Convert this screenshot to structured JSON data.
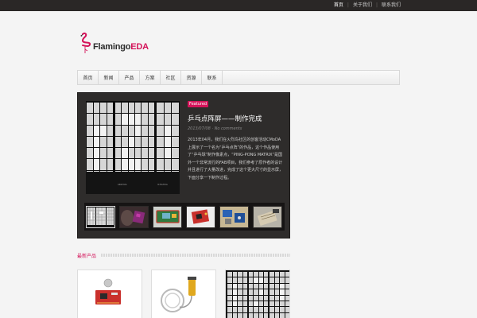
{
  "topnav": {
    "items": [
      "首页",
      "关于我们",
      "联系我们"
    ]
  },
  "logo": {
    "part1": "Flamingo",
    "part2": "EDA"
  },
  "menu": {
    "items": [
      "首页",
      "新闻",
      "产品",
      "方案",
      "社区",
      "资源",
      "联系"
    ]
  },
  "featured": {
    "badge": "Featured",
    "title": "乒乓点阵屏——制作完成",
    "meta": "2013/07/08 · No comments",
    "excerpt": "2013年04月，我们在火烈鸟社区的创客活动CMoDA上展示了一个名为“乒乓点阵”的作品，这个作品使用了“乒乓球”制作像素点，“PING-PONG MATRIX”是国外一个非常流行的FAB项目，我们参考了原作者的设计并且进行了大量改进，完成了这个更大尺寸的显示屏，下面分享一下制作过程。",
    "panel_labels": [
      "ARAHUA",
      "ICHAHUA"
    ]
  },
  "thumbs": [
    "pingpong-matrix",
    "purple-board",
    "green-board",
    "red-board",
    "blue-components",
    "pcb-workbench"
  ],
  "section": {
    "title": "最新产品"
  },
  "products": [
    "red-dev-board",
    "photoelectric-sensor",
    "pingpong-matrix"
  ],
  "colors": {
    "accent": "#d4145a",
    "topbar": "#2a2726",
    "slider_bg": "#2e2c2b"
  }
}
